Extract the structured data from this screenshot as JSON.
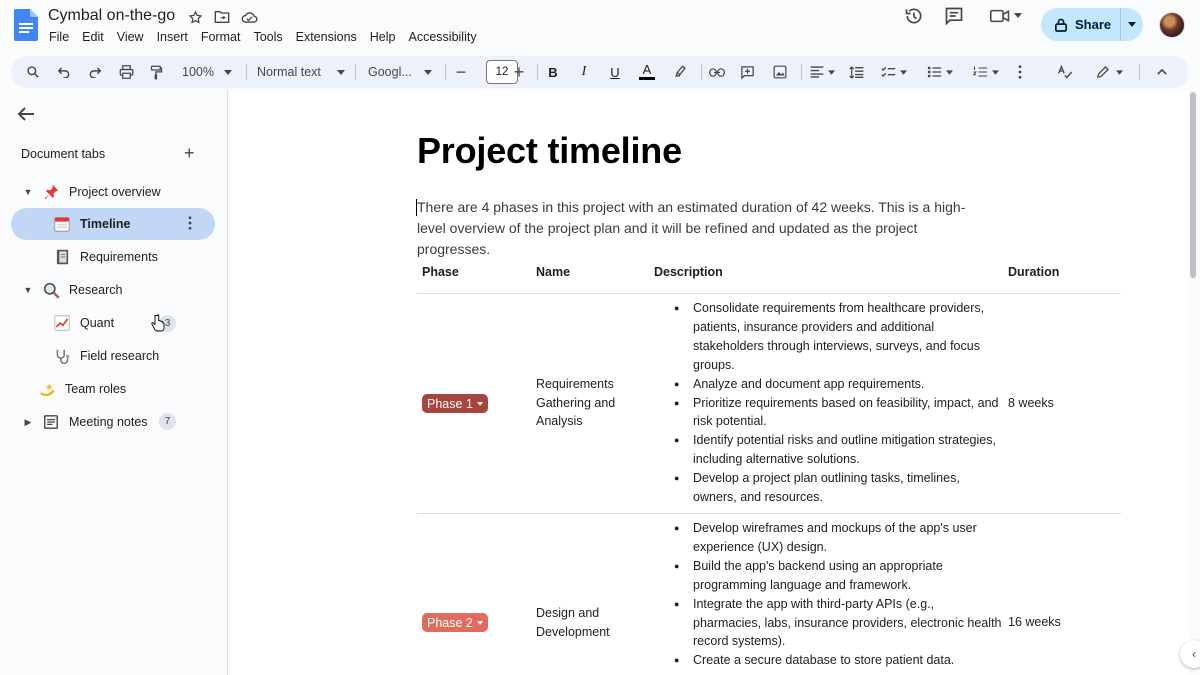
{
  "document": {
    "title": "Cymbal on-the-go",
    "menu": [
      "File",
      "Edit",
      "View",
      "Insert",
      "Format",
      "Tools",
      "Extensions",
      "Help",
      "Accessibility"
    ],
    "share_label": "Share"
  },
  "toolbar": {
    "zoom": "100%",
    "style": "Normal text",
    "font": "Googl...",
    "font_size": "12"
  },
  "sidebar": {
    "title": "Document tabs",
    "items": [
      {
        "label": "Project overview",
        "icon": "pushpin-icon",
        "expanded": true
      },
      {
        "label": "Timeline",
        "icon": "calendar-icon",
        "selected": true
      },
      {
        "label": "Requirements",
        "icon": "notebook-icon"
      },
      {
        "label": "Research",
        "icon": "magnifier-icon",
        "expanded": true
      },
      {
        "label": "Quant",
        "icon": "chart-icon",
        "badge": "3"
      },
      {
        "label": "Field research",
        "icon": "stethoscope-icon"
      },
      {
        "label": "Team roles",
        "icon": "dizzy-icon"
      },
      {
        "label": "Meeting notes",
        "icon": "doc-outline-icon",
        "badge": "7",
        "expanded": false
      }
    ]
  },
  "content": {
    "heading": "Project timeline",
    "intro": "There are 4 phases in this project with an estimated duration of 42 weeks. This is a high-level overview of the project plan and it will be refined and updated as the project progresses.",
    "table": {
      "headers": [
        "Phase",
        "Name",
        "Description",
        "Duration"
      ],
      "rows": [
        {
          "phase": "Phase 1",
          "phase_color": "#a8453f",
          "name": "Requirements Gathering and Analysis",
          "description": [
            "Consolidate requirements from healthcare providers, patients, insurance providers and additional stakeholders through interviews, surveys, and focus groups.",
            "Analyze and document app requirements.",
            "Prioritize requirements based on feasibility, impact, and risk potential.",
            "Identify potential risks and outline mitigation strategies, including alternative solutions.",
            "Develop a project plan outlining tasks, timelines, owners, and resources."
          ],
          "duration": "8 weeks"
        },
        {
          "phase": "Phase 2",
          "phase_color": "#e06b5f",
          "name": "Design and Development",
          "description": [
            "Develop wireframes and mockups of the app's user experience (UX) design.",
            "Build the app's backend using an appropriate programming language and framework.",
            "Integrate the app with third-party APIs (e.g., pharmacies, labs, insurance providers, electronic health record systems).",
            "Create a secure database to store patient data."
          ],
          "duration": "16 weeks"
        }
      ]
    }
  },
  "colors": {
    "accent": "#c2e7ff",
    "selected_tab": "#c2d7f5",
    "toolbar_bg": "#edf2fa"
  }
}
